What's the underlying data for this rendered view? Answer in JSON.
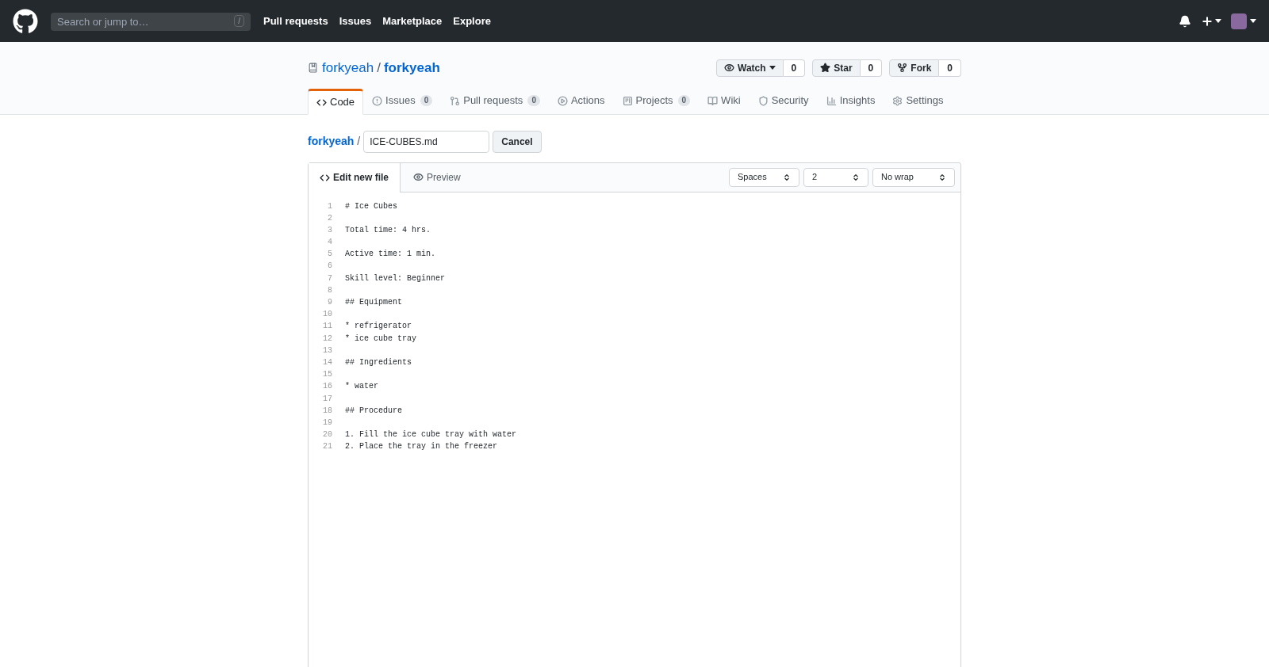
{
  "header": {
    "search": {
      "placeholder": "Search or jump to…",
      "shortcut": "/"
    },
    "nav": [
      "Pull requests",
      "Issues",
      "Marketplace",
      "Explore"
    ]
  },
  "repo": {
    "owner": "forkyeah",
    "separator": "/",
    "name": "forkyeah",
    "actions": [
      {
        "kind": "watch",
        "label": "Watch",
        "count": "0"
      },
      {
        "kind": "star",
        "label": "Star",
        "count": "0"
      },
      {
        "kind": "fork",
        "label": "Fork",
        "count": "0"
      }
    ],
    "tabs": [
      {
        "kind": "code",
        "label": "Code",
        "selected": true
      },
      {
        "kind": "issues",
        "label": "Issues",
        "counter": "0",
        "selected": false
      },
      {
        "kind": "pulls",
        "label": "Pull requests",
        "counter": "0",
        "selected": false
      },
      {
        "kind": "actions",
        "label": "Actions",
        "selected": false
      },
      {
        "kind": "projects",
        "label": "Projects",
        "counter": "0",
        "selected": false
      },
      {
        "kind": "wiki",
        "label": "Wiki",
        "selected": false
      },
      {
        "kind": "security",
        "label": "Security",
        "selected": false
      },
      {
        "kind": "insights",
        "label": "Insights",
        "selected": false
      },
      {
        "kind": "settings",
        "label": "Settings",
        "selected": false
      }
    ]
  },
  "editor": {
    "breadcrumb": "forkyeah",
    "separator": "/",
    "filename": "ICE-CUBES.md",
    "cancel": "Cancel",
    "tabs": [
      {
        "kind": "edit",
        "label": "Edit new file",
        "selected": true
      },
      {
        "kind": "preview",
        "label": "Preview",
        "selected": false
      }
    ],
    "selects": [
      "Spaces",
      "2",
      "No wrap"
    ],
    "lines": [
      {
        "number": "1",
        "text": "# Ice Cubes"
      },
      {
        "number": "2"
      },
      {
        "number": "3",
        "text": "Total time: 4 hrs."
      },
      {
        "number": "4"
      },
      {
        "number": "5",
        "text": "Active time: 1 min."
      },
      {
        "number": "6"
      },
      {
        "number": "7",
        "text": "Skill level: Beginner"
      },
      {
        "number": "8"
      },
      {
        "number": "9",
        "text": "## Equipment"
      },
      {
        "number": "10"
      },
      {
        "number": "11",
        "text": "* refrigerator"
      },
      {
        "number": "12",
        "text": "* ice cube tray"
      },
      {
        "number": "13"
      },
      {
        "number": "14",
        "text": "## Ingredients"
      },
      {
        "number": "15"
      },
      {
        "number": "16",
        "text": "* water"
      },
      {
        "number": "17"
      },
      {
        "number": "18",
        "text": "## Procedure"
      },
      {
        "number": "19"
      },
      {
        "number": "20",
        "text": "1. Fill the ice cube tray with water"
      },
      {
        "number": "21",
        "text": "2. Place the tray in the freezer"
      }
    ]
  }
}
